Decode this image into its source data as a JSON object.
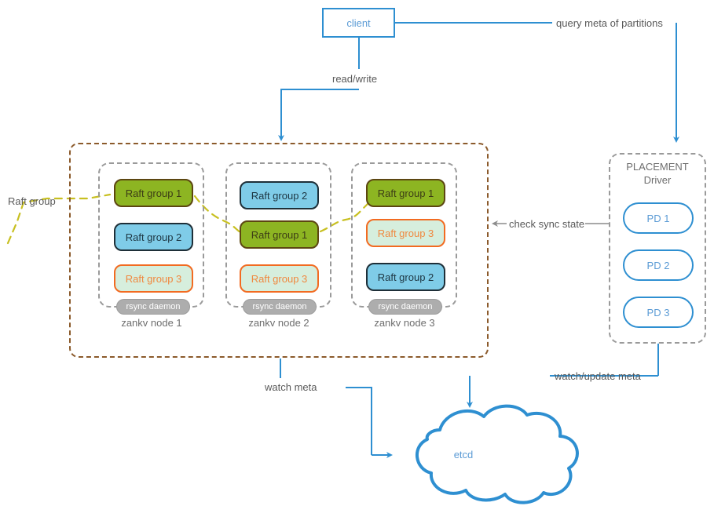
{
  "diagram": {
    "client": {
      "label": "client"
    },
    "edges": {
      "query_meta": "query meta of partitions",
      "read_write": "read/write",
      "check_sync": "check sync state",
      "watch_meta": "watch meta",
      "watch_update_meta": "watch/update meta",
      "raft_group": "Raft group"
    },
    "nodes": [
      {
        "name": "zankv node 1",
        "groups": [
          {
            "label": "Raft group 1",
            "style": "green"
          },
          {
            "label": "Raft group 2",
            "style": "blue"
          },
          {
            "label": "Raft group 3",
            "style": "mint"
          }
        ],
        "daemon": "rsync daemon"
      },
      {
        "name": "zankv node 2",
        "groups": [
          {
            "label": "Raft group 2",
            "style": "blue"
          },
          {
            "label": "Raft group 1",
            "style": "green"
          },
          {
            "label": "Raft group 3",
            "style": "mint"
          }
        ],
        "daemon": "rsync daemon"
      },
      {
        "name": "zankv node 3",
        "groups": [
          {
            "label": "Raft group 1",
            "style": "green"
          },
          {
            "label": "Raft group 3",
            "style": "mint"
          },
          {
            "label": "Raft group 2",
            "style": "blue"
          }
        ],
        "daemon": "rsync daemon"
      }
    ],
    "placement_driver": {
      "title_line1": "PLACEMENT",
      "title_line2": "Driver",
      "members": [
        "PD 1",
        "PD 2",
        "PD 3"
      ]
    },
    "etcd": {
      "label": "etcd"
    },
    "colors": {
      "accent_blue": "#2E8FD1",
      "text_blue": "#5B9BD5",
      "green_fill": "#8DB522",
      "green_border": "#5C4611",
      "blue_fill": "#7FCCE8",
      "blue_border": "#1E2F38",
      "mint_fill": "#D6EEDD",
      "orange_border": "#F26B21",
      "orange_text": "#F0883F",
      "cluster_brown": "#8B5A2B",
      "node_gray": "#9A9A9A",
      "daemon_gray": "#ADADAD",
      "raft_link_yellow": "#C8C021",
      "label_gray": "#595959"
    }
  }
}
